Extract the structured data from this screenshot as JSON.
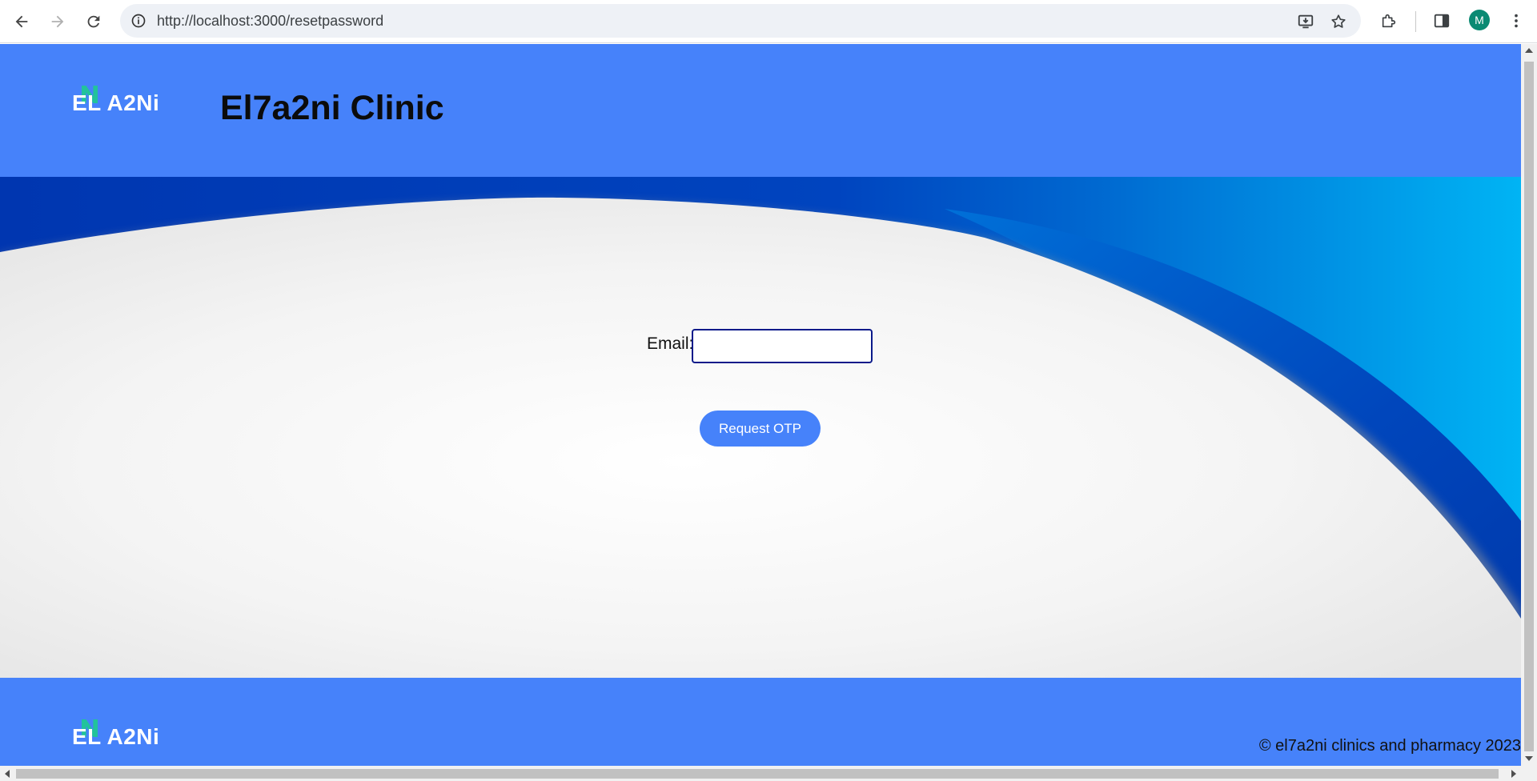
{
  "browser": {
    "url": "http://localhost:3000/resetpassword",
    "profile_initial": "M",
    "icons": {
      "back": "arrow-left-icon",
      "forward": "arrow-right-icon",
      "reload": "reload-icon",
      "site_info": "info-icon",
      "install": "install-app-icon",
      "bookmark": "star-icon",
      "extensions": "puzzle-icon",
      "side_panel": "side-panel-icon",
      "menu": "kebab-menu-icon"
    }
  },
  "header": {
    "logo_text": "EL A2Ni",
    "title": "El7a2ni Clinic"
  },
  "form": {
    "email_label": "Email:",
    "email_value": "",
    "request_button": "Request OTP"
  },
  "footer": {
    "logo_text": "EL A2Ni",
    "copyright": "© el7a2ni clinics and pharmacy 2023"
  },
  "colors": {
    "brand_blue": "#4682fa",
    "logo_accent": "#22c39b",
    "input_border": "#0b1a8a",
    "avatar": "#0b8a73"
  }
}
